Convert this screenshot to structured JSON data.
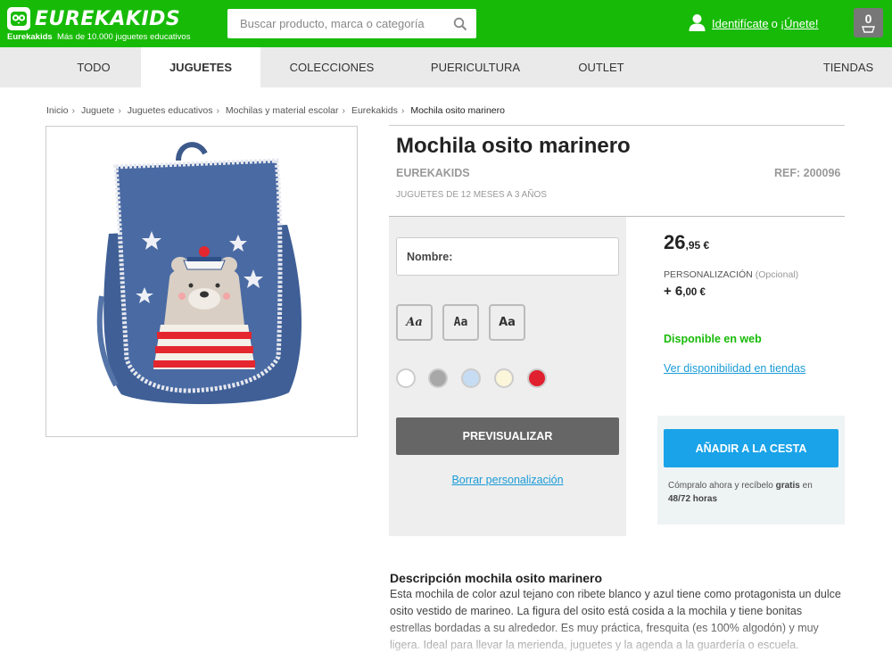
{
  "header": {
    "logo_text": "EUREKAKIDS",
    "tagline_brand": "Eurekakids",
    "tagline_text": "Más de 10.000 juguetes educativos",
    "search_placeholder": "Buscar producto, marca o categoría",
    "login_label": "Identifícate",
    "or_label": "o",
    "signup_label": "¡Únete!",
    "cart_count": "0",
    "brand_color": "#17bb07"
  },
  "nav": {
    "items": [
      {
        "label": "TODO"
      },
      {
        "label": "JUGUETES"
      },
      {
        "label": "COLECCIONES"
      },
      {
        "label": "PUERICULTURA"
      },
      {
        "label": "OUTLET"
      },
      {
        "label": "TIENDAS"
      }
    ],
    "active": "JUGUETES"
  },
  "breadcrumb": [
    "Inicio",
    "Juguete",
    "Juguetes educativos",
    "Mochilas y material escolar",
    "Eurekakids",
    "Mochila osito marinero"
  ],
  "product": {
    "title": "Mochila osito marinero",
    "brand": "EUREKAKIDS",
    "ref": "REF: 200096",
    "age": "JUGUETES DE 12 MESES A 3 AÑOS",
    "price_int": "26",
    "price_dec": ",95 €",
    "personalization_label": "PERSONALIZACIÓN",
    "personalization_optional": "(Opcional)",
    "personalization_price_int": "+ 6",
    "personalization_price_dec": ",00 €",
    "availability": "Disponible en web",
    "stores_link": "Ver disponibilidad en tiendas",
    "add_to_cart": "AÑADIR A LA CESTA",
    "shipping_pre": "Cómpralo ahora y recíbelo",
    "shipping_bold": "gratis",
    "shipping_mid": "en",
    "shipping_time": "48/72 horas"
  },
  "customizer": {
    "name_label": "Nombre:",
    "name_value": "",
    "font_options": [
      "Aa",
      "Aa",
      "Aa"
    ],
    "colors": [
      "#ffffff",
      "#a8a8a8",
      "#c5dcf2",
      "#fbf5da",
      "#e0202e"
    ],
    "preview_button": "PREVISUALIZAR",
    "reset_link": "Borrar personalización"
  },
  "description": {
    "title": "Descripción mochila osito marinero",
    "text": "Esta mochila de color azul tejano con ribete blanco y azul tiene como protagonista un dulce osito vestido de marineo. La figura del osito está cosida a la mochila y tiene bonitas estrellas bordadas a su alrededor. Es muy práctica, fresquita (es 100% algodón) y muy ligera. Ideal para llevar la merienda, juguetes y la agenda a la guardería o escuela."
  }
}
